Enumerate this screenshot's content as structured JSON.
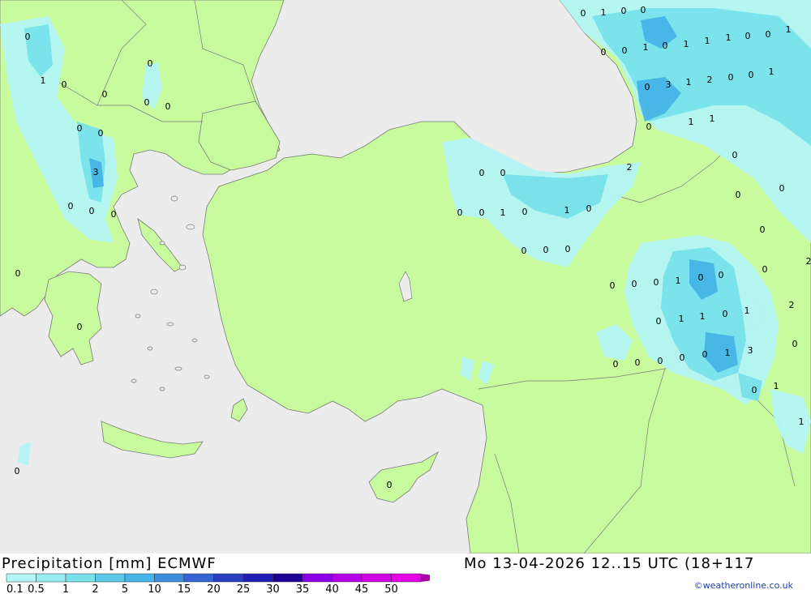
{
  "header": {
    "title": "Precipitation [mm] ECMWF",
    "valid_time": "Mo 13-04-2026 12..15 UTC (18+117",
    "credit": "©weatheronline.co.uk"
  },
  "colorscale": {
    "labels": [
      "0.1",
      "0.5",
      "1",
      "2",
      "5",
      "10",
      "15",
      "20",
      "25",
      "30",
      "35",
      "40",
      "45",
      "50"
    ],
    "colors": [
      "#b4f5f5",
      "#96ecf0",
      "#78e1eb",
      "#5ac8e6",
      "#46b4e6",
      "#3c8cdc",
      "#3264d2",
      "#283cbe",
      "#1e1eb4",
      "#1e0096",
      "#8c00e6",
      "#b400e6",
      "#d200e6",
      "#e600e6",
      "#aa00aa"
    ]
  },
  "colors": {
    "sea": "#ececec",
    "land": "#c8fa9e",
    "precip_light": "#b4f5f5",
    "precip_medium": "#78e1eb",
    "precip_heavy": "#46b4e6"
  },
  "station_values": [
    "0",
    "0",
    "1",
    "0",
    "1",
    "0",
    "0",
    "0",
    "0",
    "0",
    "0",
    "0",
    "0",
    "3",
    "0",
    "0",
    "0",
    "0",
    "0",
    "0",
    "0",
    "0",
    "1",
    "0",
    "1",
    "1",
    "1",
    "0",
    "0",
    "1",
    "1",
    "0",
    "3",
    "1",
    "2",
    "0",
    "0",
    "1",
    "0",
    "1",
    "1",
    "0",
    "2",
    "0",
    "0",
    "0",
    "0",
    "0",
    "0",
    "1",
    "0",
    "1",
    "0",
    "0",
    "0",
    "0",
    "0",
    "0",
    "2",
    "0",
    "0",
    "0",
    "1",
    "0",
    "0",
    "2",
    "1",
    "0",
    "1",
    "1",
    "0",
    "0",
    "0",
    "0",
    "0",
    "0",
    "0",
    "1",
    "3",
    "1",
    "0",
    "1",
    "0",
    "1",
    "0"
  ]
}
